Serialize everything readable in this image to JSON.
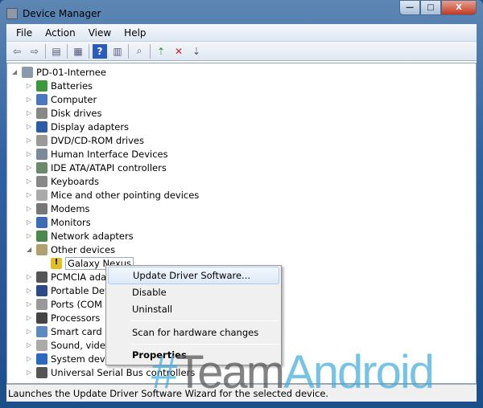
{
  "window": {
    "title": "Device Manager",
    "minimize": "—",
    "maximize": "□",
    "close": "X"
  },
  "menu": [
    "File",
    "Action",
    "View",
    "Help"
  ],
  "toolbar": [
    "back-icon",
    "forward-icon",
    "show-hide-tree-icon",
    "properties-icon",
    "help-icon",
    "action-pane-icon",
    "scan-hardware-icon",
    "update-driver-icon",
    "uninstall-icon",
    "disable-icon"
  ],
  "tree": {
    "root": "PD-01-Internee",
    "items": [
      {
        "label": "Batteries",
        "color": "#3a9a3a"
      },
      {
        "label": "Computer",
        "color": "#4a78c0"
      },
      {
        "label": "Disk drives",
        "color": "#888888"
      },
      {
        "label": "Display adapters",
        "color": "#2a5ca8"
      },
      {
        "label": "DVD/CD-ROM drives",
        "color": "#999999"
      },
      {
        "label": "Human Interface Devices",
        "color": "#7a8a99"
      },
      {
        "label": "IDE ATA/ATAPI controllers",
        "color": "#6b8a6b"
      },
      {
        "label": "Keyboards",
        "color": "#888888"
      },
      {
        "label": "Mice and other pointing devices",
        "color": "#aaaaaa"
      },
      {
        "label": "Modems",
        "color": "#777777"
      },
      {
        "label": "Monitors",
        "color": "#3a6db5"
      },
      {
        "label": "Network adapters",
        "color": "#4a8a4a"
      },
      {
        "label": "Other devices",
        "color": "#b0a070",
        "expanded": true,
        "children": [
          {
            "label": "Galaxy Nexus",
            "color": "#e0c020",
            "warning": true
          }
        ]
      },
      {
        "label": "PCMCIA adapters",
        "color": "#555555"
      },
      {
        "label": "Portable Devices",
        "color": "#2a4a8a"
      },
      {
        "label": "Ports (COM & LPT)",
        "color": "#999999"
      },
      {
        "label": "Processors",
        "color": "#444444"
      },
      {
        "label": "Smart card readers",
        "color": "#5a8ac0"
      },
      {
        "label": "Sound, video and game controllers",
        "color": "#aaaaaa"
      },
      {
        "label": "System devices",
        "color": "#2a6ac0"
      },
      {
        "label": "Universal Serial Bus controllers",
        "color": "#555555"
      }
    ]
  },
  "context_menu": {
    "items": [
      "Update Driver Software...",
      "Disable",
      "Uninstall",
      "Scan for hardware changes",
      "Properties"
    ]
  },
  "status": "Launches the Update Driver Software Wizard for the selected device.",
  "watermark": {
    "hash": "#",
    "team": "Team",
    "android": "Android"
  }
}
